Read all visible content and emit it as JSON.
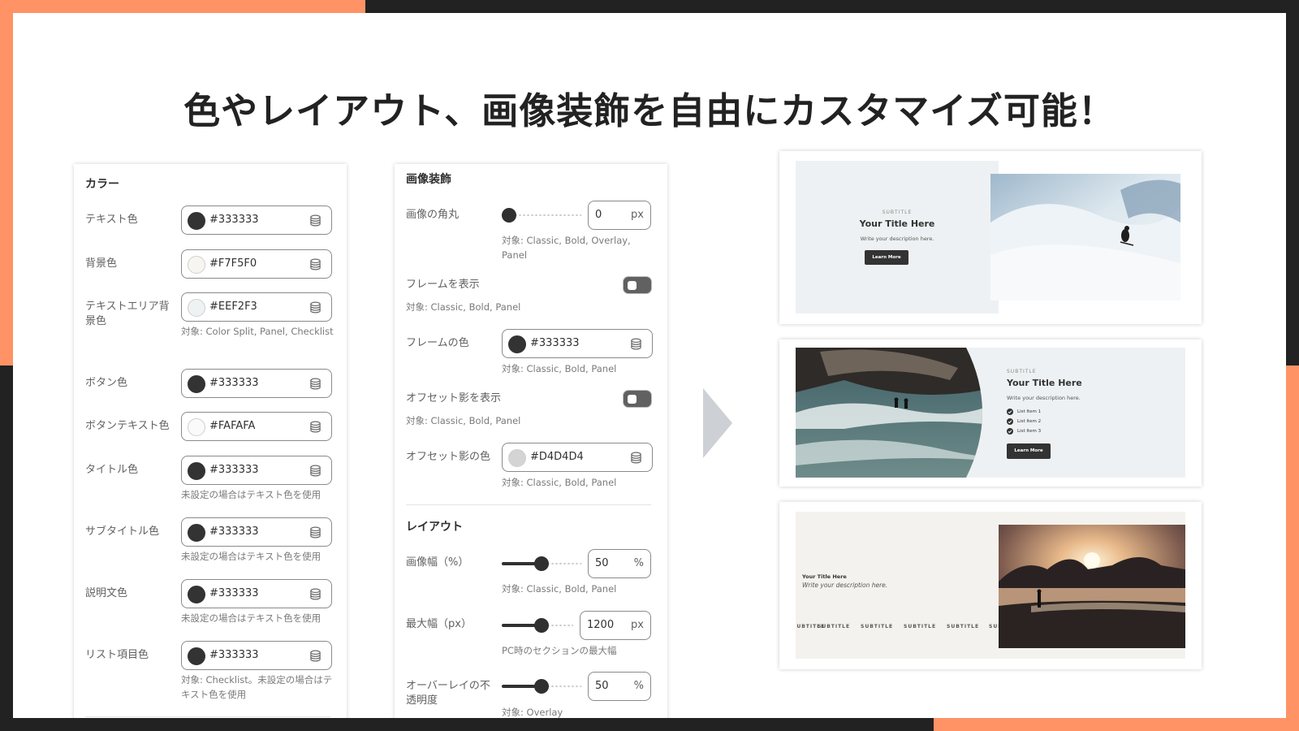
{
  "headline": "色やレイアウト、画像装飾を自由にカスタマイズ可能！",
  "colors_panel": {
    "title": "カラー",
    "fields": [
      {
        "label": "テキスト色",
        "value": "#333333",
        "swatch": "#333333"
      },
      {
        "label": "背景色",
        "value": "#F7F5F0",
        "swatch": "#F7F5F0"
      },
      {
        "label": "テキストエリア背景色",
        "value": "#EEF2F3",
        "swatch": "#EEF2F3",
        "note": "対象: Color Split, Panel, Checklist"
      },
      {
        "label": "ボタン色",
        "value": "#333333",
        "swatch": "#333333"
      },
      {
        "label": "ボタンテキスト色",
        "value": "#FAFAFA",
        "swatch": "#FAFAFA"
      },
      {
        "label": "タイトル色",
        "value": "#333333",
        "swatch": "#333333",
        "note": "未設定の場合はテキスト色を使用"
      },
      {
        "label": "サブタイトル色",
        "value": "#333333",
        "swatch": "#333333",
        "note": "未設定の場合はテキスト色を使用"
      },
      {
        "label": "説明文色",
        "value": "#333333",
        "swatch": "#333333",
        "note": "未設定の場合はテキスト色を使用"
      },
      {
        "label": "リスト項目色",
        "value": "#333333",
        "swatch": "#333333",
        "note": "対象: Checklist。未設定の場合はテキスト色を使用"
      }
    ]
  },
  "image_panel": {
    "title": "画像装飾",
    "corner": {
      "label": "画像の角丸",
      "value": "0",
      "unit": "px",
      "level": 0,
      "note": "対象: Classic, Bold, Overlay, Panel"
    },
    "frame_toggle": {
      "label": "フレームを表示",
      "on": false,
      "note": "対象: Classic, Bold, Panel"
    },
    "frame_color": {
      "label": "フレームの色",
      "value": "#333333",
      "swatch": "#333333",
      "note": "対象: Classic, Bold, Panel"
    },
    "shadow_toggle": {
      "label": "オフセット影を表示",
      "on": false,
      "note": "対象: Classic, Bold, Panel"
    },
    "shadow_color": {
      "label": "オフセット影の色",
      "value": "#D4D4D4",
      "swatch": "#D4D4D4",
      "note": "対象: Classic, Bold, Panel"
    },
    "layout_title": "レイアウト",
    "image_width": {
      "label": "画像幅（%）",
      "value": "50",
      "unit": "%",
      "level": 0.5,
      "note": "対象: Classic, Bold, Panel"
    },
    "max_width": {
      "label": "最大幅（px）",
      "value": "1200",
      "unit": "px",
      "level": 0.57,
      "note": "PC時のセクションの最大幅"
    },
    "overlay": {
      "label": "オーバーレイの不透明度",
      "value": "50",
      "unit": "%",
      "level": 0.5,
      "note": "対象: Overlay"
    }
  },
  "previews": [
    {
      "subtitle": "SUBTITLE",
      "title": "Your Title Here",
      "desc": "Write your description here.",
      "button": "Learn More"
    },
    {
      "subtitle": "SUBTITLE",
      "title": "Your Title Here",
      "desc": "Write your description here.",
      "items": [
        "List Item 1",
        "List Item 2",
        "List Item 3"
      ],
      "button": "Learn More"
    },
    {
      "title": "Your Title Here",
      "desc": "Write your description here.",
      "marquee": "SUBTITLE"
    }
  ],
  "colors": {
    "accent": "#FF9366",
    "dark": "#222222"
  }
}
